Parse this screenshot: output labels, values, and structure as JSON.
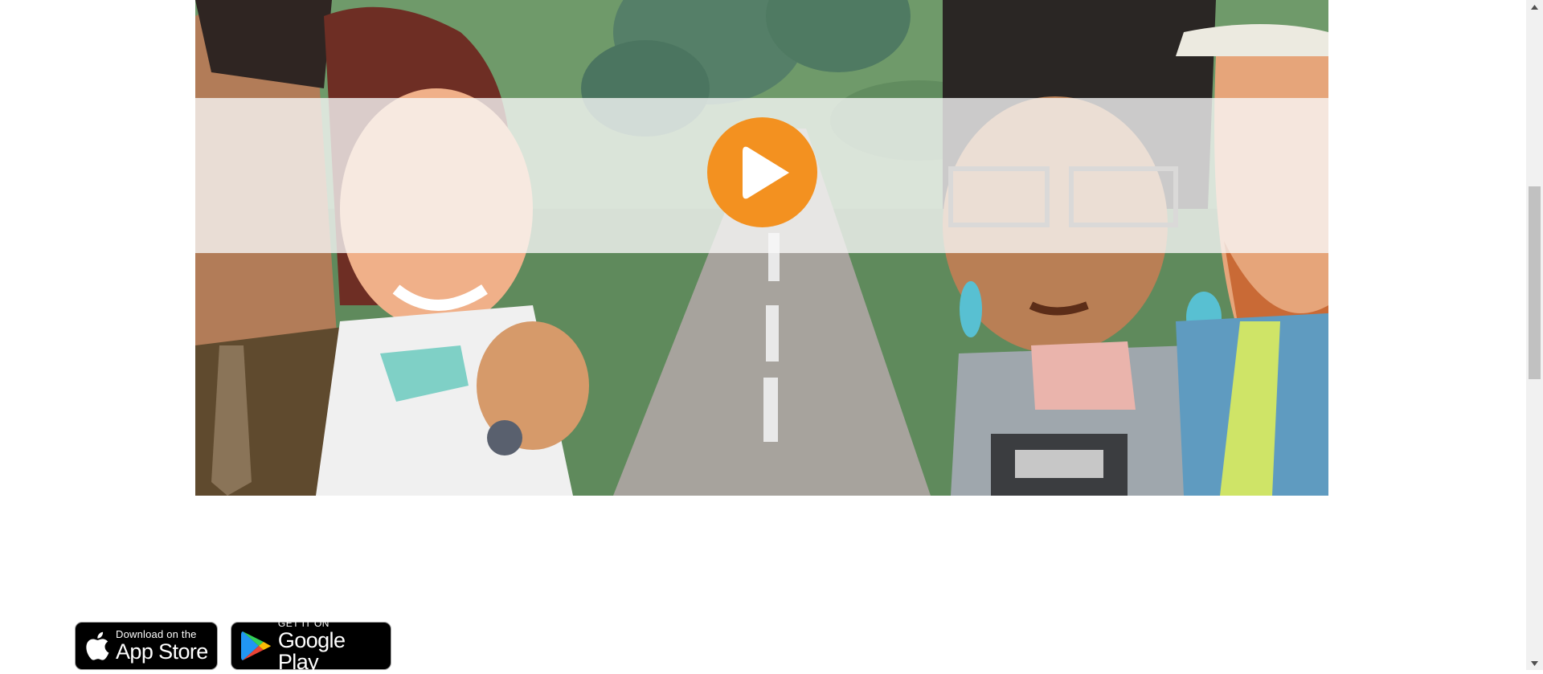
{
  "video": {
    "play_icon": "play-icon",
    "accent_color": "#f39120"
  },
  "store_badges": {
    "app_store": {
      "small": "Download on the",
      "big": "App Store",
      "icon": "apple-logo-icon"
    },
    "google_play": {
      "small": "GET IT ON",
      "big": "Google Play",
      "icon": "google-play-logo-icon"
    }
  },
  "scrollbar": {
    "up_icon": "scroll-up-arrow-icon",
    "down_icon": "scroll-down-arrow-icon"
  }
}
